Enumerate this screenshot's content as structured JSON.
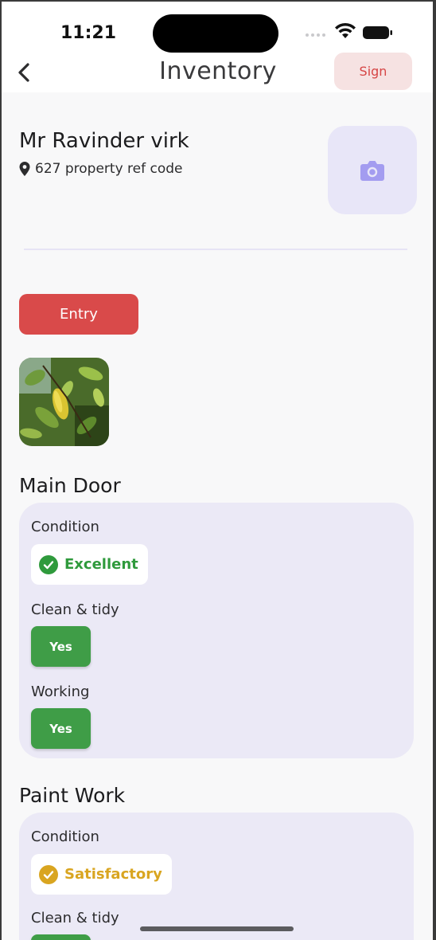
{
  "status_bar": {
    "time": "11:21"
  },
  "nav": {
    "title": "Inventory",
    "sign_label": "Sign"
  },
  "header": {
    "owner_name": "Mr Ravinder virk",
    "address": "627 property ref code"
  },
  "entry_label": "Entry",
  "sections": [
    {
      "title": "Main Door",
      "condition_label": "Condition",
      "condition_value": "Excellent",
      "clean_label": "Clean & tidy",
      "clean_value": "Yes",
      "working_label": "Working",
      "working_value": "Yes"
    },
    {
      "title": "Paint Work",
      "condition_label": "Condition",
      "condition_value": "Satisfactory",
      "clean_label": "Clean & tidy"
    }
  ],
  "colors": {
    "accent_red": "#d94a4a",
    "yes_green": "#3f9d47",
    "excellent_green": "#2f9a3c",
    "satisfactory_gold": "#d9a520",
    "card_bg": "#ebe9f6"
  },
  "icons": [
    "back-chevron-icon",
    "map-pin-icon",
    "camera-icon",
    "check-circle-icon",
    "wifi-icon",
    "battery-icon"
  ]
}
